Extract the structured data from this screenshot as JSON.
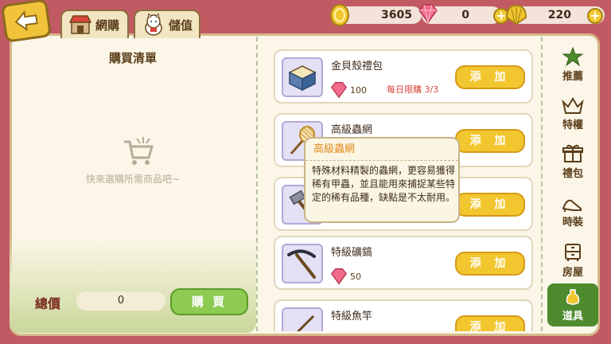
{
  "top_tabs": [
    {
      "label": "網購",
      "icon": "shop-stall-icon"
    },
    {
      "label": "儲值",
      "icon": "lucky-cat-icon"
    }
  ],
  "currency": {
    "coins": "3605",
    "gems": "0",
    "shells": "220"
  },
  "cart": {
    "title": "購買清單",
    "empty_text": "快來選購所需商品吧~",
    "total_label": "總價",
    "total_value": "0",
    "buy_label": "購 買"
  },
  "items": [
    {
      "name": "金貝殼禮包",
      "price": "100",
      "limit": "每日限購 3/3",
      "add_label": "添 加",
      "icon": "gift-box-icon"
    },
    {
      "name": "高級蟲網",
      "price": "",
      "limit": "",
      "add_label": "添 加",
      "icon": "bug-net-icon"
    },
    {
      "name": "",
      "price": "",
      "limit": "",
      "add_label": "添 加",
      "icon": "hammer-icon"
    },
    {
      "name": "特級礦鎬",
      "price": "50",
      "limit": "",
      "add_label": "添 加",
      "icon": "pickaxe-icon"
    },
    {
      "name": "特級魚竿",
      "price": "",
      "limit": "",
      "add_label": "添 加",
      "icon": "fishing-rod-icon"
    }
  ],
  "tooltip": {
    "title": "高級蟲網",
    "body": "特殊材料精製的蟲網，更容易獲得稀有甲蟲，並且能用來捕捉某些特定的稀有品種，缺點是不太耐用。"
  },
  "categories": [
    {
      "label": "推薦",
      "icon": "star-icon"
    },
    {
      "label": "特權",
      "icon": "crown-icon"
    },
    {
      "label": "禮包",
      "icon": "gift-icon"
    },
    {
      "label": "時裝",
      "icon": "high-heel-icon"
    },
    {
      "label": "房屋",
      "icon": "cabinet-icon"
    },
    {
      "label": "道具",
      "icon": "bottle-icon",
      "active": true
    }
  ],
  "colors": {
    "accent_yellow": "#f2c62f",
    "buy_green": "#8dcb52",
    "limit_red": "#d8453b",
    "frame": "#c25a63"
  }
}
